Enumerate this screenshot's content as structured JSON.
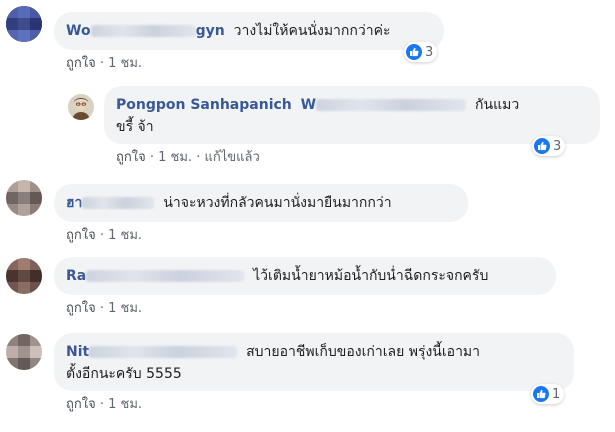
{
  "comments": [
    {
      "author_visible": "Wo",
      "author_tail": "gyn",
      "text": "วางไม่ให้คนนั่งมากกว่าค่ะ",
      "like_label": "ถูกใจ",
      "time": "1 ชม.",
      "reactions": "3",
      "reply": {
        "author": "Pongpon Sanhapanich",
        "mention_visible": "W",
        "text_line1": "กันแมว",
        "text_line2": "ขรี้ จ้า",
        "like_label": "ถูกใจ",
        "time": "1 ชม.",
        "edited": "แก้ไขแล้ว",
        "reactions": "3"
      }
    },
    {
      "author_visible": "ฮา",
      "text": "น่าจะหวงที่กลัวคนมานั่งมายืนมากกว่า",
      "like_label": "ถูกใจ",
      "time": "1 ชม."
    },
    {
      "author_visible": "Ra",
      "text": "ไว้เติมน้ำยาหม้อน้ำกับน่ำฉีดกระจกครับ",
      "like_label": "ถูกใจ",
      "time": "1 ชม."
    },
    {
      "author_visible": "Nit",
      "text_line1": "สบายอาชีพเก็บของเก่าเลย พรุ่งนี้เอามา",
      "text_line2": "ตั้งอีกนะครับ 5555",
      "like_label": "ถูกใจ",
      "time": "1 ชม.",
      "reactions": "1"
    }
  ],
  "separator": "·",
  "colors": {
    "name": "#385898",
    "bubble": "#f2f3f5",
    "like": "#1877f2"
  },
  "icons": {
    "like": "thumbs-up-icon"
  }
}
